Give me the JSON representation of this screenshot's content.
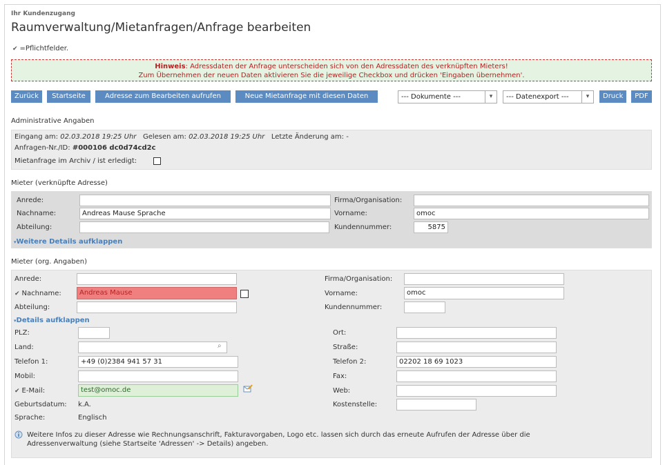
{
  "header": {
    "small_title": "Ihr Kundenzugang",
    "title": "Raumverwaltung/Mietanfragen/Anfrage bearbeiten",
    "required_note": "=Pflichtfelder."
  },
  "notice": {
    "label": "Hinweis",
    "line1": ": Adressdaten der Anfrage unterscheiden sich von den Adressdaten des verknüpften Mieters!",
    "line2": "Zum Übernehmen der neuen Daten aktivieren Sie die jeweilige Checkbox und drücken 'Eingaben übernehmen'."
  },
  "toolbar": {
    "back": "Zurück",
    "start": "Startseite",
    "edit_address": "Adresse zum Bearbeiten aufrufen",
    "new_request": "Neue Mietanfrage mit diesen Daten",
    "documents": "--- Dokumente ---",
    "export": "--- Datenexport ---",
    "print": "Druck",
    "pdf": "PDF"
  },
  "admin": {
    "section": "Administrative Angaben",
    "received_label": "Eingang am:",
    "received_value": "02.03.2018 19:25 Uhr",
    "read_label": "Gelesen am:",
    "read_value": "02.03.2018 19:25 Uhr",
    "changed_label": "Letzte Änderung am:",
    "changed_value": "-",
    "id_label": "Anfragen-Nr./ID:",
    "id_value": "#000106 dc0d74cd2c",
    "archive_label": "Mietanfrage im Archiv / ist erledigt:"
  },
  "linked": {
    "section": "Mieter (verknüpfte Adresse)",
    "anrede_label": "Anrede:",
    "anrede_value": "",
    "firma_label": "Firma/Organisation:",
    "firma_value": "",
    "nachname_label": "Nachname:",
    "nachname_value": "Andreas Mause Sprache",
    "vorname_label": "Vorname:",
    "vorname_value": "omoc",
    "abteilung_label": "Abteilung:",
    "abteilung_value": "",
    "kundennr_label": "Kundennummer:",
    "kundennr_value": "5875",
    "more_details": "Weitere Details aufklappen"
  },
  "original": {
    "section": "Mieter (org. Angaben)",
    "anrede_label": "Anrede:",
    "anrede_value": "",
    "firma_label": "Firma/Organisation:",
    "firma_value": "",
    "nachname_label": "Nachname:",
    "nachname_value": "Andreas Mause",
    "vorname_label": "Vorname:",
    "vorname_value": "omoc",
    "abteilung_label": "Abteilung:",
    "abteilung_value": "",
    "kundennr_label": "Kundennummer:",
    "kundennr_value": "",
    "details": "Details aufklappen",
    "plz_label": "PLZ:",
    "plz_value": "",
    "ort_label": "Ort:",
    "ort_value": "",
    "land_label": "Land:",
    "land_value": "",
    "strasse_label": "Straße:",
    "strasse_value": "",
    "tel1_label": "Telefon 1:",
    "tel1_value": "+49 (0)2384 941 57 31",
    "tel2_label": "Telefon 2:",
    "tel2_value": "02202 18 69 1023",
    "mobil_label": "Mobil:",
    "mobil_value": "",
    "fax_label": "Fax:",
    "fax_value": "",
    "email_label": "E-Mail:",
    "email_value": "test@omoc.de",
    "web_label": "Web:",
    "web_value": "",
    "geburt_label": "Geburtsdatum:",
    "geburt_value": "k.A.",
    "kosten_label": "Kostenstelle:",
    "kosten_value": "",
    "sprache_label": "Sprache:",
    "sprache_value": "Englisch",
    "info_line1": "Weitere Infos zu dieser Adresse wie Rechnungsanschrift, Fakturavorgaben, Logo etc. lassen sich durch das erneute Aufrufen der Adresse über die",
    "info_line2": "Adressenverwaltung (siehe Startseite 'Adressen' -> Details) angeben."
  },
  "colors": {
    "button": "#5b8bc0",
    "link": "#4a7fb8",
    "error_field": "#f08080",
    "ok_field": "#dff0d8",
    "notice_bg": "#e4f3e2",
    "notice_text": "#b22222"
  },
  "icons": {
    "required": "checkmark-icon",
    "search": "search-icon",
    "edit": "edit-mail-icon",
    "info": "info-icon",
    "expand": "expand-arrow-icon"
  }
}
